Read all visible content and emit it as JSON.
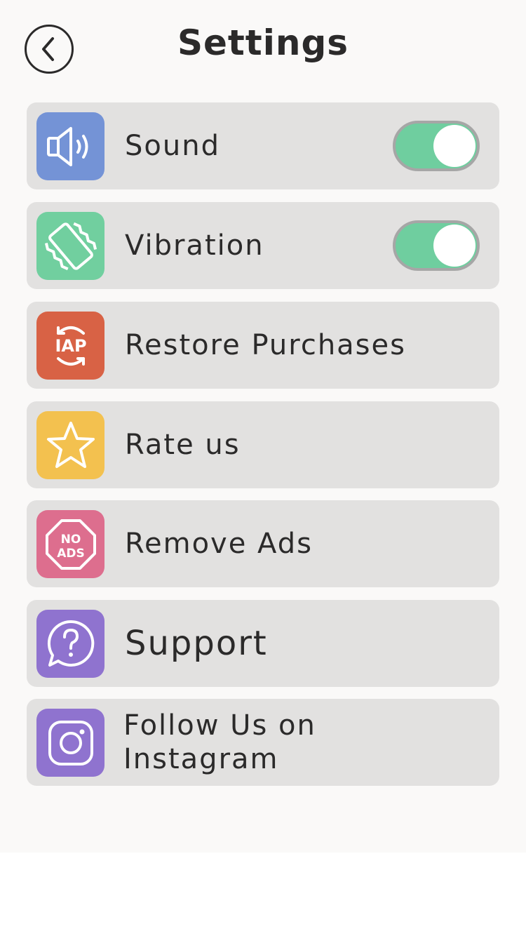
{
  "header": {
    "title": "Settings",
    "back_icon": "chevron-left-icon"
  },
  "colors": {
    "background": "#faf9f8",
    "row_background": "#e2e1e0",
    "toggle_on": "#6fce9f",
    "text": "#2b2a2a"
  },
  "settings": {
    "items": [
      {
        "label": "Sound",
        "icon": "speaker-icon",
        "icon_color": "#7493d6",
        "toggle": true,
        "toggle_on": true
      },
      {
        "label": "Vibration",
        "icon": "vibration-icon",
        "icon_color": "#71cf9f",
        "toggle": true,
        "toggle_on": true
      },
      {
        "label": "Restore Purchases",
        "icon": "iap-restore-icon",
        "icon_text": "IAP",
        "icon_color": "#d86245"
      },
      {
        "label": "Rate us",
        "icon": "star-icon",
        "icon_color": "#f3c14f"
      },
      {
        "label": "Remove Ads",
        "icon": "no-ads-icon",
        "icon_text_top": "NO",
        "icon_text_bottom": "ADS",
        "icon_color": "#dd6e8e"
      },
      {
        "label": "Support",
        "icon": "help-chat-icon",
        "icon_color": "#8f73cf"
      },
      {
        "label": "Follow Us on Instagram",
        "icon": "instagram-icon",
        "icon_color": "#8f73cf"
      }
    ]
  }
}
